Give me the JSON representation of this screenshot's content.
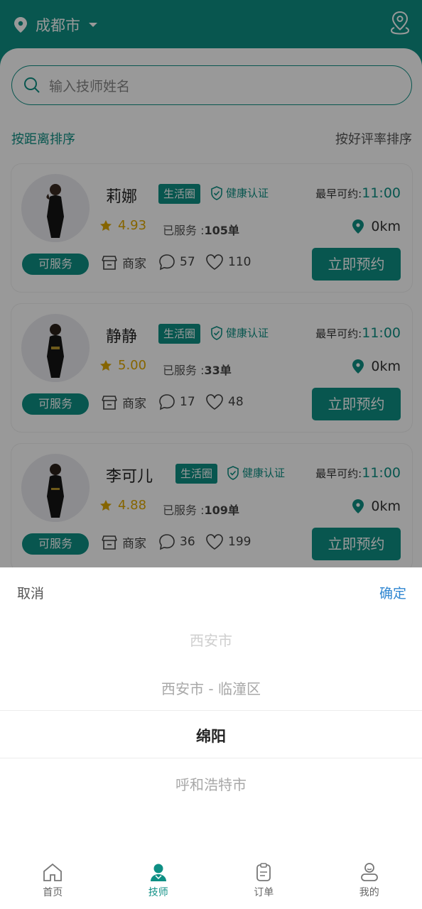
{
  "header": {
    "city": "成都市"
  },
  "search": {
    "placeholder": "输入技师姓名"
  },
  "sort": {
    "by_distance": "按距离排序",
    "by_rating": "按好评率排序"
  },
  "cards": [
    {
      "name": "莉娜",
      "tag": "生活圈",
      "health": "健康认证",
      "earliest_label": "最早可约:",
      "earliest_time": "11:00",
      "rating": "4.93",
      "served_label": "已服务 :",
      "served_count": "105单",
      "distance": "0km",
      "status": "可服务",
      "merchant": "商家",
      "comments": "57",
      "likes": "110",
      "book": "立即预约"
    },
    {
      "name": "静静",
      "tag": "生活圈",
      "health": "健康认证",
      "earliest_label": "最早可约:",
      "earliest_time": "11:00",
      "rating": "5.00",
      "served_label": "已服务 :",
      "served_count": "33单",
      "distance": "0km",
      "status": "可服务",
      "merchant": "商家",
      "comments": "17",
      "likes": "48",
      "book": "立即预约"
    },
    {
      "name": "李可儿",
      "tag": "生活圈",
      "health": "健康认证",
      "earliest_label": "最早可约:",
      "earliest_time": "11:00",
      "rating": "4.88",
      "served_label": "已服务 :",
      "served_count": "109单",
      "distance": "0km",
      "status": "可服务",
      "merchant": "商家",
      "comments": "36",
      "likes": "199",
      "book": "立即预约"
    }
  ],
  "picker": {
    "cancel": "取消",
    "confirm": "确定",
    "options": [
      "西安市",
      "西安市 - 临潼区",
      "绵阳",
      "呼和浩特市"
    ],
    "selected": "绵阳"
  },
  "nav": {
    "items": [
      {
        "label": "首页",
        "icon": "home-icon"
      },
      {
        "label": "技师",
        "icon": "technician-icon",
        "active": true
      },
      {
        "label": "订单",
        "icon": "order-icon"
      },
      {
        "label": "我的",
        "icon": "profile-icon"
      }
    ]
  },
  "colors": {
    "primary": "#0e8f84",
    "confirm": "#2f86d1",
    "rating": "#e0a800"
  }
}
